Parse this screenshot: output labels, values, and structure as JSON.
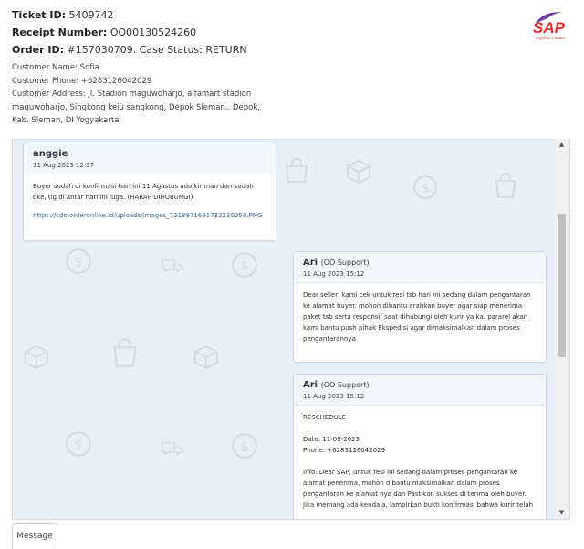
{
  "ticket": {
    "ticket_label": "Ticket ID:",
    "ticket_id": "5409742",
    "receipt_label": "Receipt Number:",
    "receipt_number": "OO00130524260",
    "order_label": "Order ID:",
    "order_text": "#157030709. Case Status: RETURN",
    "customer_name": "Customer Name: Sofia",
    "customer_phone": "Customer Phone: +6283126042029",
    "customer_address": "Customer Address: Jl. Stadion maguwoharjo, alfamart stadion maguwoharjo, Singkong keju sangkong, Depok Sleman.. Depok, Kab. Sleman, DI Yogyakarta"
  },
  "logo": {
    "text": "SAP",
    "subtext": "Express Courier",
    "color": "#e5322d",
    "accent": "#6b3fa0"
  },
  "messages": [
    {
      "name": "anggie",
      "role": "",
      "time": "11 Aug 2023 12:37",
      "body": "Buyer sudah di konfirmasi hari ini 11 Agustus ada kiriman dan sudah oke, tlg di antar hari ini juga. (HARAP DIHUBUNGI)",
      "link": "https://cdn.orderonline.id/uploads/images_7218871691732230058.PNG"
    },
    {
      "name": "Ari",
      "role": "(OO Support)",
      "time": "11 Aug 2023 15:12",
      "body": "Dear seller, kami cek untuk resi tsb hari ini sedang dalam pengantaran ke alamat buyer. mohon dibantu arahkan buyer agar siap menerima paket tsb serta responsif saat dihubungi oleh kurir ya ka. pararel akan kami bantu push pihak Ekspedisi agar dimaksimalkan dalam proses pengantarannya"
    },
    {
      "name": "Ari",
      "role": "(OO Support)",
      "time": "11 Aug 2023 15:12",
      "lines": [
        "RESCHEDULE",
        "",
        "Date: 11-08-2023",
        "Phone: +6283126042029",
        "",
        "Info: Dear SAP, untuk resi ini sedang dalam proses pengantaran ke alamat penerima, mohon dibantu maksimalkan dalam proses pengantaran ke alamat nya dan Pastikan sukses di terima oleh buyer. Jika memang ada kendala, lampirkan bukti konfirmasi bahwa kurir telah"
      ]
    }
  ],
  "message_button": "Message",
  "icons": {
    "bg_colors": "#d3dbe8",
    "scroll_up": "scroll-up-arrow",
    "scroll_down": "scroll-down-arrow"
  }
}
